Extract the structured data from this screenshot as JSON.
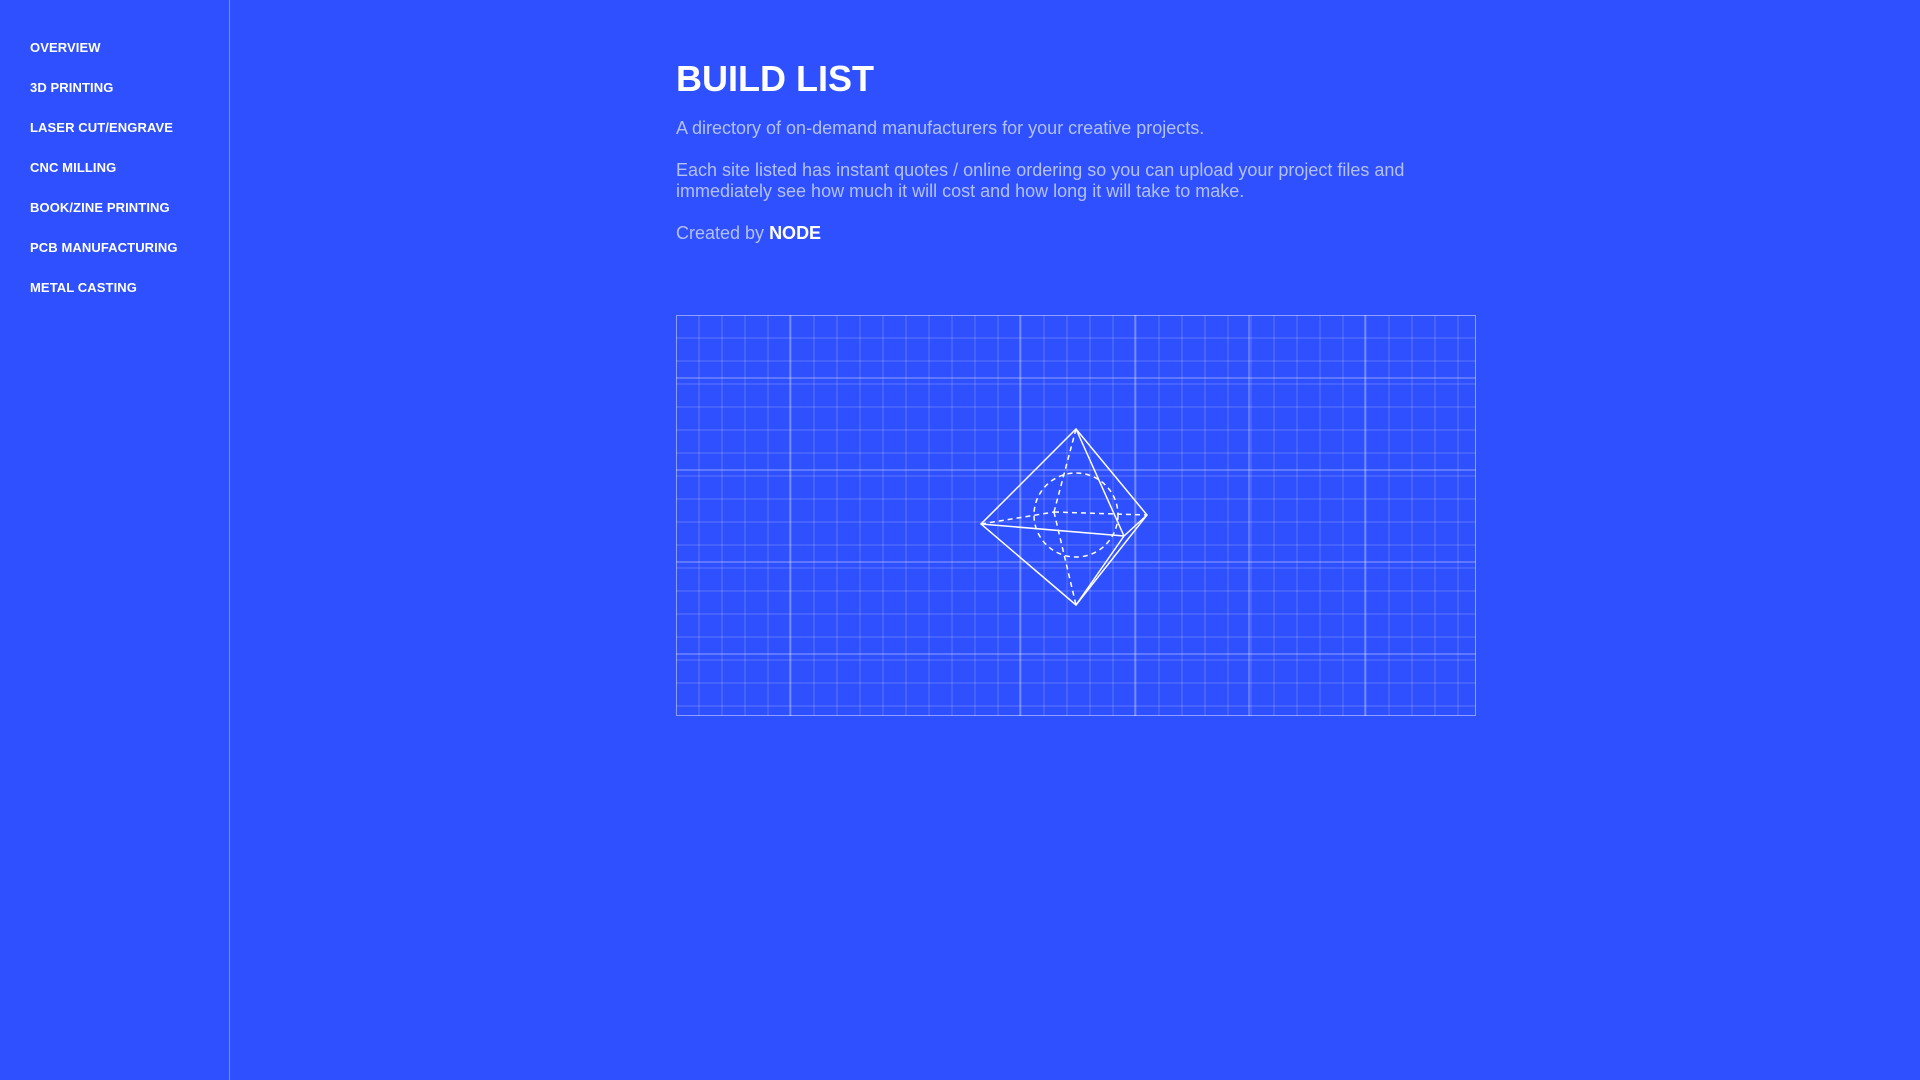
{
  "sidebar": {
    "items": [
      {
        "label": "OVERVIEW"
      },
      {
        "label": "3D PRINTING"
      },
      {
        "label": "LASER CUT/ENGRAVE"
      },
      {
        "label": "CNC MILLING"
      },
      {
        "label": "BOOK/ZINE PRINTING"
      },
      {
        "label": "PCB MANUFACTURING"
      },
      {
        "label": "METAL CASTING"
      }
    ]
  },
  "main": {
    "title": "BUILD LIST",
    "intro": "A directory of on-demand manufacturers for your creative projects.",
    "description": "Each site listed has instant quotes / online ordering so you can upload your project files and immediately see how much it will cost and how long it will take to make.",
    "credit_prefix": "Created by ",
    "credit_name": "NODE"
  },
  "illustration": {
    "icon": "octahedron-wireframe-icon",
    "line_color": "#ffffff"
  },
  "colors": {
    "background": "#2f50ff",
    "text_muted": "#b3c0f4",
    "text_strong": "#ffffff"
  }
}
